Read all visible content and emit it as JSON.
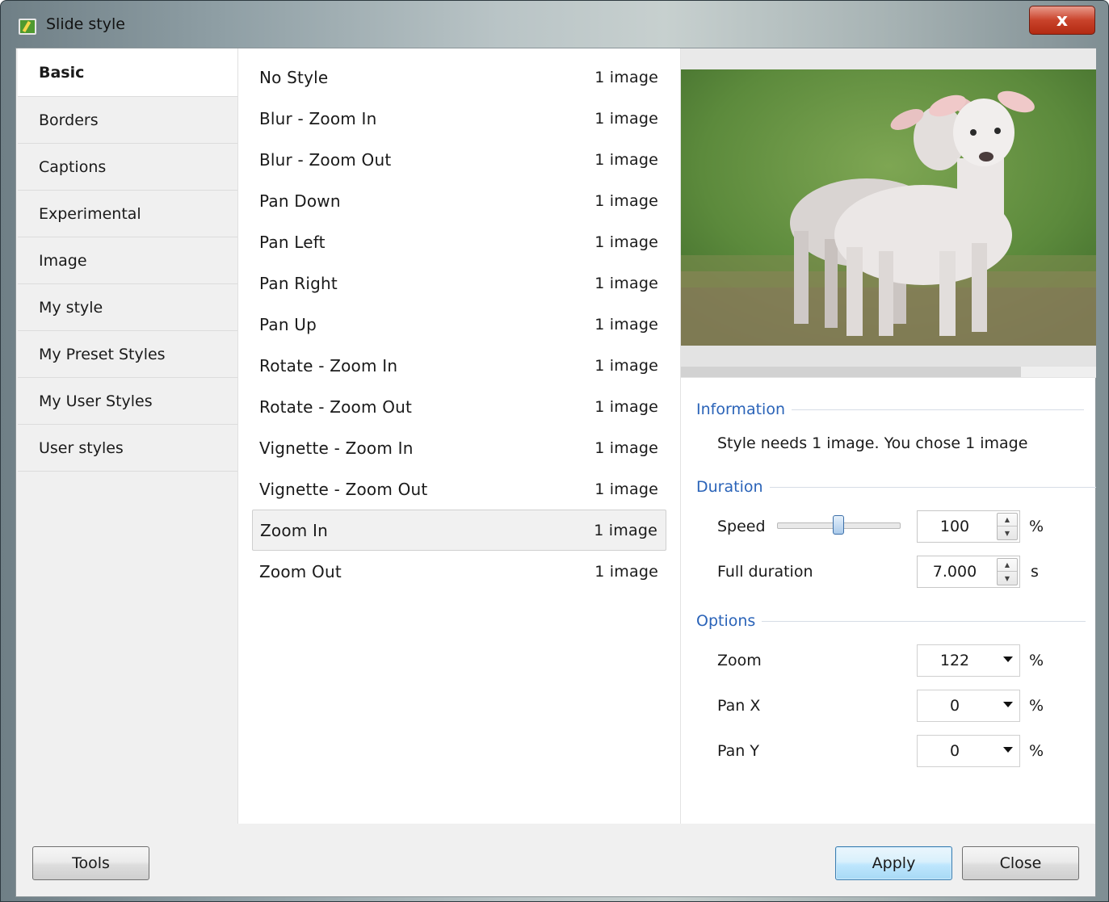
{
  "window": {
    "title": "Slide style",
    "close_label": "x"
  },
  "sidebar": {
    "items": [
      {
        "label": "Basic",
        "active": true
      },
      {
        "label": "Borders"
      },
      {
        "label": "Captions"
      },
      {
        "label": "Experimental"
      },
      {
        "label": "Image"
      },
      {
        "label": "My style"
      },
      {
        "label": "My Preset Styles"
      },
      {
        "label": "My User Styles"
      },
      {
        "label": "User styles"
      }
    ]
  },
  "styles": [
    {
      "name": "No Style",
      "count": "1 image"
    },
    {
      "name": "Blur - Zoom In",
      "count": "1 image"
    },
    {
      "name": "Blur - Zoom Out",
      "count": "1 image"
    },
    {
      "name": "Pan Down",
      "count": "1 image"
    },
    {
      "name": "Pan Left",
      "count": "1 image"
    },
    {
      "name": "Pan Right",
      "count": "1 image"
    },
    {
      "name": "Pan Up",
      "count": "1 image"
    },
    {
      "name": "Rotate - Zoom In",
      "count": "1 image"
    },
    {
      "name": "Rotate - Zoom Out",
      "count": "1 image"
    },
    {
      "name": "Vignette - Zoom In",
      "count": "1 image"
    },
    {
      "name": "Vignette - Zoom Out",
      "count": "1 image"
    },
    {
      "name": "Zoom In",
      "count": "1 image",
      "selected": true
    },
    {
      "name": "Zoom Out",
      "count": "1 image"
    }
  ],
  "preview": {
    "progress": 0.82
  },
  "information": {
    "title": "Information",
    "text": "Style needs 1 image. You chose 1 image"
  },
  "duration": {
    "title": "Duration",
    "speed_label": "Speed",
    "speed_value": "100",
    "speed_unit": "%",
    "full_label": "Full duration",
    "full_value": "7.000",
    "full_unit": "s"
  },
  "options": {
    "title": "Options",
    "zoom_label": "Zoom",
    "zoom_value": "122",
    "zoom_unit": "%",
    "panx_label": "Pan X",
    "panx_value": "0",
    "panx_unit": "%",
    "pany_label": "Pan Y",
    "pany_value": "0",
    "pany_unit": "%"
  },
  "buttons": {
    "tools": "Tools",
    "apply": "Apply",
    "close": "Close"
  },
  "colors": {
    "accent": "#2a63b8",
    "close_button": "#c9432b",
    "default_button": "#bee6fd"
  }
}
